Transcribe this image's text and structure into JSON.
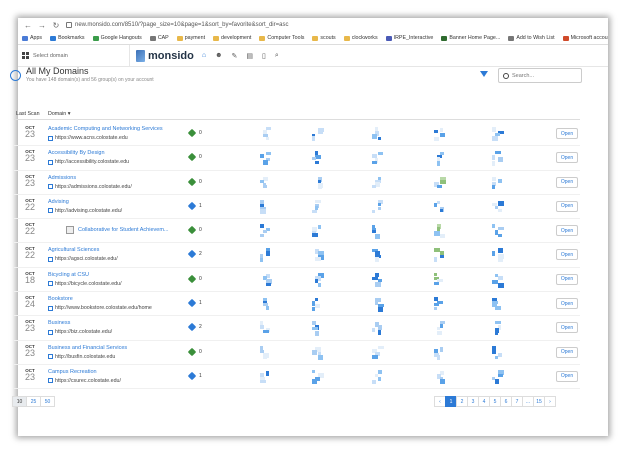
{
  "browser": {
    "url": "new.monsido.com/8510/?page_size=10&page=1&sort_by=favorite&sort_dir=asc",
    "bookmarks": [
      "Apps",
      "Bookmarks",
      "Google Hangouts",
      "CAP",
      "payment",
      "development",
      "Computer Tools",
      "scouts",
      "clockworks",
      "IRPE_Interactive",
      "Banner Home Page...",
      "Add to Wish List",
      "Microsoft accou"
    ]
  },
  "app": {
    "domain_select": "Select domain",
    "logo": "monsido",
    "nav_icons": [
      "home-icon",
      "users-icon",
      "wrench-icon",
      "chart-icon",
      "document-icon",
      "search-icon"
    ]
  },
  "page": {
    "title": "All My Domains",
    "subtitle": "You have 148 domain(s) and 56 group(s) on your account",
    "search_placeholder": "Search..."
  },
  "table": {
    "col_last_scan": "Last Scan",
    "col_domain": "Domain ▾",
    "open_label": "Open",
    "rows": [
      {
        "mon": "OCT",
        "day": "23",
        "name": "Academic Computing and Networking Services",
        "url": "https://www.acns.colostate.edu",
        "count": "0",
        "icon": "green",
        "group": false
      },
      {
        "mon": "OCT",
        "day": "23",
        "name": "Accessibility By Design",
        "url": "http://accessibility.colostate.edu",
        "count": "0",
        "icon": "green",
        "group": false
      },
      {
        "mon": "OCT",
        "day": "23",
        "name": "Admissions",
        "url": "https://admissions.colostate.edu/",
        "count": "0",
        "icon": "green",
        "group": false
      },
      {
        "mon": "OCT",
        "day": "22",
        "name": "Advising",
        "url": "http://advising.colostate.edu/",
        "count": "1",
        "icon": "blue",
        "group": false
      },
      {
        "mon": "OCT",
        "day": "22",
        "name": "Collaborative for Student Achievem...",
        "url": "",
        "count": "0",
        "icon": "green",
        "group": true
      },
      {
        "mon": "OCT",
        "day": "22",
        "name": "Agricultural Sciences",
        "url": "https://agsci.colostate.edu/",
        "count": "2",
        "icon": "blue",
        "group": false
      },
      {
        "mon": "OCT",
        "day": "18",
        "name": "Bicycling at CSU",
        "url": "https://bicycle.colostate.edu/",
        "count": "0",
        "icon": "green",
        "group": false
      },
      {
        "mon": "OCT",
        "day": "24",
        "name": "Bookstore",
        "url": "http://www.bookstore.colostate.edu/home",
        "count": "1",
        "icon": "blue",
        "group": false
      },
      {
        "mon": "OCT",
        "day": "23",
        "name": "Business",
        "url": "https://biz.colostate.edu/",
        "count": "2",
        "icon": "blue",
        "group": false
      },
      {
        "mon": "OCT",
        "day": "23",
        "name": "Business and Financial Services",
        "url": "http://busfin.colostate.edu",
        "count": "0",
        "icon": "green",
        "group": false
      },
      {
        "mon": "OCT",
        "day": "23",
        "name": "Campus Recreation",
        "url": "https://csurec.colostate.edu/",
        "count": "1",
        "icon": "blue",
        "group": false
      }
    ]
  },
  "footer": {
    "page_sizes": [
      "10",
      "25",
      "50"
    ],
    "pages": [
      "‹",
      "1",
      "2",
      "3",
      "4",
      "5",
      "6",
      "7",
      "...",
      "15",
      "›"
    ]
  }
}
